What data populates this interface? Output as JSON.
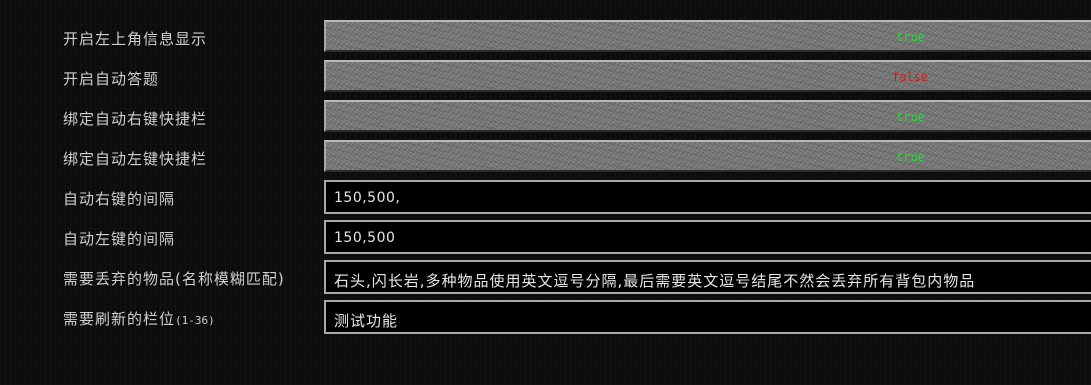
{
  "settings": {
    "show_info": {
      "label": "开启左上角信息显示",
      "value": "true"
    },
    "auto_answer": {
      "label": "开启自动答题",
      "value": "false"
    },
    "bind_right": {
      "label": "绑定自动右键快捷栏",
      "value": "true"
    },
    "bind_left": {
      "label": "绑定自动左键快捷栏",
      "value": "true"
    },
    "right_interval": {
      "label": "自动右键的间隔",
      "value": "150,500,"
    },
    "left_interval": {
      "label": "自动左键的间隔",
      "value": "150,500"
    },
    "discard_items": {
      "label": "需要丢弃的物品(名称模糊匹配)",
      "value": "石头,闪长岩,多种物品使用英文逗号分隔,最后需要英文逗号结尾不然会丢弃所有背包内物品"
    },
    "refresh_slots": {
      "label_main": "需要刷新的栏位",
      "label_range": "(1-36)",
      "value": "测试功能"
    }
  },
  "colors": {
    "true_color": "#2ed33a",
    "false_color": "#cc1d1d",
    "label_color": "#cfcfcf"
  }
}
